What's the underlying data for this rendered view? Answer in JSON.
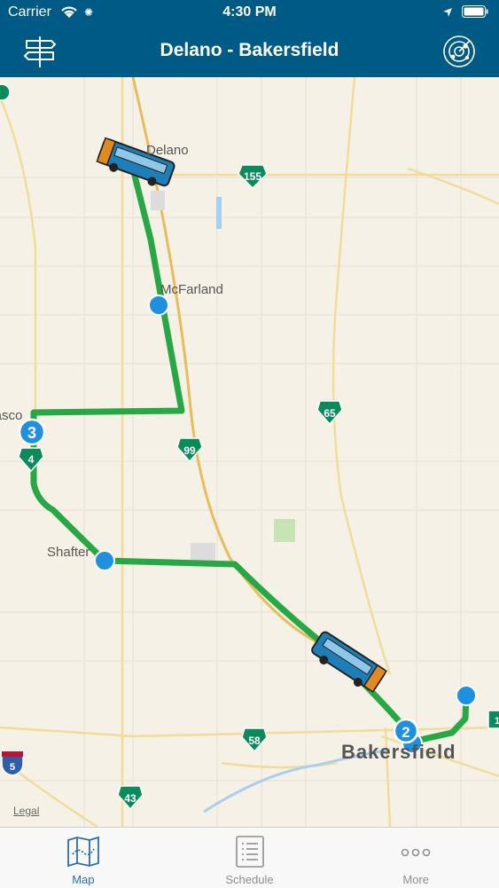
{
  "status": {
    "carrier": "Carrier",
    "time": "4:30 PM"
  },
  "nav": {
    "title": "Delano - Bakersfield",
    "left_icon": "signpost-icon",
    "right_icon": "radar-icon"
  },
  "map": {
    "cities": {
      "delano": "Delano",
      "mcfarland": "McFarland",
      "wasco": "Wasco",
      "shafter": "Shafter",
      "bakersfield": "Bakersfield"
    },
    "highways": [
      "155",
      "65",
      "99",
      "58",
      "5",
      "43",
      "4"
    ],
    "stop_badges": [
      "3",
      "2"
    ],
    "legal": "Legal",
    "colors": {
      "route": "#27a844",
      "stop": "#1f8fe0",
      "bus_body": "#1e7fb8",
      "bus_trim": "#e08a20"
    }
  },
  "tabs": [
    {
      "label": "Map",
      "icon": "map-icon",
      "active": true
    },
    {
      "label": "Schedule",
      "icon": "schedule-icon",
      "active": false
    },
    {
      "label": "More",
      "icon": "more-icon",
      "active": false
    }
  ]
}
